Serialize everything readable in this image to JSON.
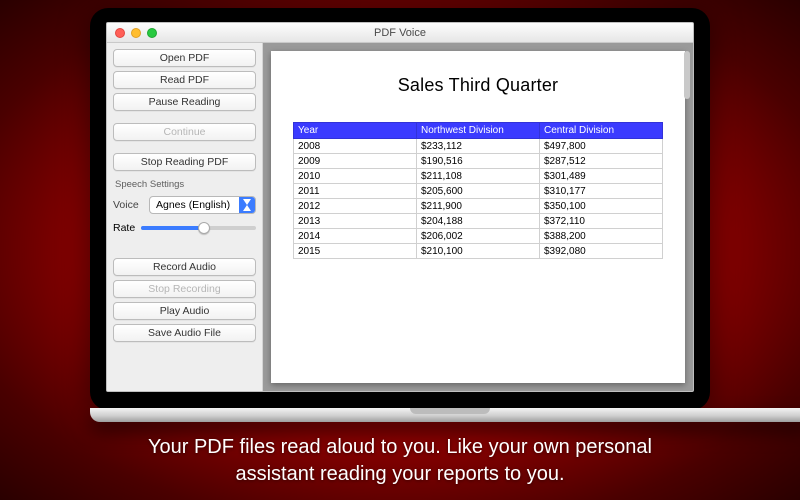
{
  "window": {
    "title": "PDF Voice"
  },
  "sidebar": {
    "open_pdf": "Open PDF",
    "read_pdf": "Read PDF",
    "pause_reading": "Pause Reading",
    "continue": "Continue",
    "stop_reading": "Stop Reading PDF",
    "speech_settings_label": "Speech Settings",
    "voice_label": "Voice",
    "voice_selected": "Agnes (English)",
    "rate_label": "Rate",
    "record_audio": "Record Audio",
    "stop_recording": "Stop Recording",
    "play_audio": "Play Audio",
    "save_audio": "Save Audio File"
  },
  "document": {
    "title": "Sales Third Quarter",
    "columns": {
      "c0": "Year",
      "c1": "Northwest Division",
      "c2": "Central Division"
    },
    "rows": [
      {
        "year": "2008",
        "nw": "$233,112",
        "cd": "$497,800"
      },
      {
        "year": "2009",
        "nw": "$190,516",
        "cd": "$287,512"
      },
      {
        "year": "2010",
        "nw": "$211,108",
        "cd": "$301,489"
      },
      {
        "year": "2011",
        "nw": "$205,600",
        "cd": "$310,177"
      },
      {
        "year": "2012",
        "nw": "$211,900",
        "cd": "$350,100"
      },
      {
        "year": "2013",
        "nw": "$204,188",
        "cd": "$372,110"
      },
      {
        "year": "2014",
        "nw": "$206,002",
        "cd": "$388,200"
      },
      {
        "year": "2015",
        "nw": "$210,100",
        "cd": "$392,080"
      }
    ]
  },
  "caption": {
    "line1": "Your PDF files read aloud to you. Like your own personal",
    "line2": "assistant reading your reports to you."
  },
  "chart_data": {
    "type": "table",
    "title": "Sales Third Quarter",
    "columns": [
      "Year",
      "Northwest Division",
      "Central Division"
    ],
    "rows": [
      [
        2008,
        233112,
        497800
      ],
      [
        2009,
        190516,
        287512
      ],
      [
        2010,
        211108,
        301489
      ],
      [
        2011,
        205600,
        310177
      ],
      [
        2012,
        211900,
        350100
      ],
      [
        2013,
        204188,
        372110
      ],
      [
        2014,
        206002,
        388200
      ],
      [
        2015,
        210100,
        392080
      ]
    ]
  }
}
